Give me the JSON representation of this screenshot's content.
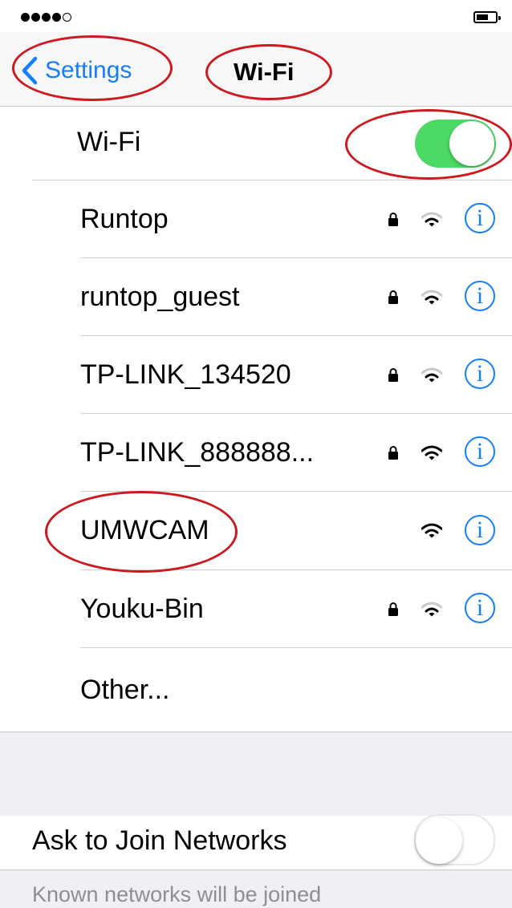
{
  "nav": {
    "back_label": "Settings",
    "title": "Wi-Fi"
  },
  "wifi_toggle": {
    "label": "Wi-Fi",
    "state": "on"
  },
  "networks": [
    {
      "name": "Runtop",
      "locked": true,
      "signal": "medium",
      "info": "i"
    },
    {
      "name": "runtop_guest",
      "locked": true,
      "signal": "medium",
      "info": "i"
    },
    {
      "name": "TP-LINK_134520",
      "locked": true,
      "signal": "medium",
      "info": "i"
    },
    {
      "name": "TP-LINK_888888...",
      "locked": true,
      "signal": "full",
      "info": "i"
    },
    {
      "name": "UMWCAM",
      "locked": false,
      "signal": "full",
      "info": "i"
    },
    {
      "name": "Youku-Bin",
      "locked": true,
      "signal": "medium",
      "info": "i"
    }
  ],
  "other_label": "Other...",
  "ask_to_join": {
    "label": "Ask to Join Networks",
    "state": "off"
  },
  "footer_text": "Known networks will be joined",
  "colors": {
    "accent": "#147efb",
    "toggle_on": "#4cd964",
    "annotation": "#cc1a20",
    "group_background": "#efeff4"
  }
}
